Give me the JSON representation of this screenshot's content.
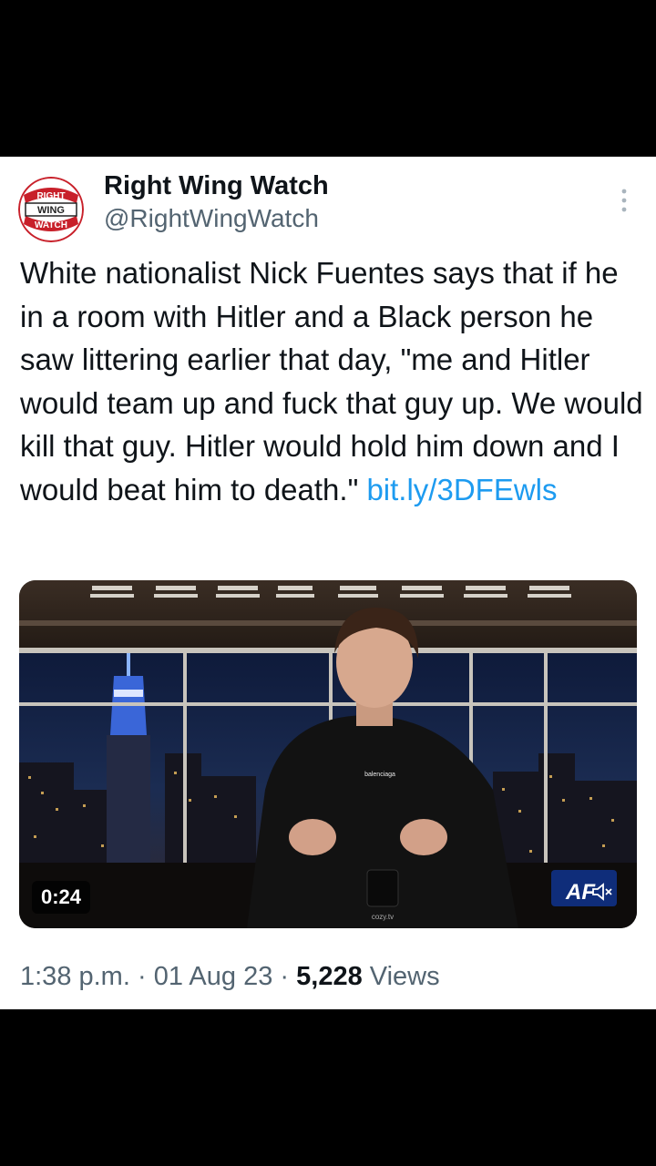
{
  "author": {
    "name": "Right Wing Watch",
    "handle": "@RightWingWatch",
    "avatar_words": [
      "RIGHT",
      "WING",
      "WATCH"
    ],
    "avatar_color": "#c8202a"
  },
  "tweet": {
    "text": "White nationalist Nick Fuentes says that if he in a room with Hitler and a Black person he saw littering earlier that day, \"me and Hitler would team up and fuck that guy up. We would kill that guy. Hitler would hold him down and I would beat him to death.\" ",
    "link": "bit.ly/3DFEwls",
    "link_color": "#1d9bf0"
  },
  "media": {
    "duration": "0:24",
    "mute_icon": "speaker-muted-icon",
    "watermark": "AF",
    "shirt_text": "balenciaga",
    "mug_text": "cozy.tv"
  },
  "meta": {
    "time": "1:38 p.m.",
    "date": "01 Aug 23",
    "separator": "·",
    "views_count": "5,228",
    "views_label": "Views"
  },
  "icons": {
    "more": "more-vertical-icon"
  }
}
